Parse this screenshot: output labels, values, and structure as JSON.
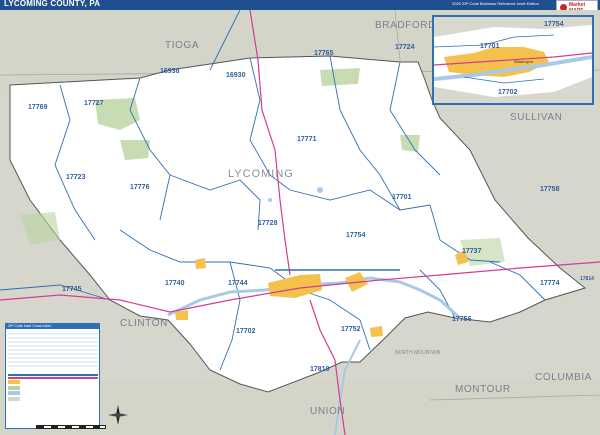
{
  "map": {
    "title": "LYCOMING COUNTY, PA",
    "subtitle": "2020 ZIP Code Business Reference Inset Edition",
    "brand": "Market MAPS",
    "colors": {
      "county_fill": "#ffffff",
      "surrounding": "#d6d6cc",
      "zip_boundary": "#2f6fb3",
      "water": "#a9c9e6",
      "urban": "#f5c14d",
      "park": "#b9d3a0",
      "highway": "#d63b8f",
      "title_bar": "#1f4f8f"
    }
  },
  "counties": {
    "tioga": "TIOGA",
    "bradford": "BRADFORD",
    "sullivan": "SULLIVAN",
    "lycoming": "LYCOMING",
    "clinton": "CLINTON",
    "montour": "MONTOUR",
    "columbia": "COLUMBIA",
    "union": "UNION"
  },
  "zip_codes": {
    "z16938": "16938",
    "z16930": "16930",
    "z17765": "17765",
    "z17724": "17724",
    "z17769": "17769",
    "z17727": "17727",
    "z17771": "17771",
    "z17723": "17723",
    "z17776": "17776",
    "z17758": "17758",
    "z17701": "17701",
    "z17728": "17728",
    "z17754": "17754",
    "z17737": "17737",
    "z17740": "17740",
    "z17744": "17744",
    "z17774": "17774",
    "z17745": "17745",
    "z17814": "17814",
    "z17756": "17756",
    "z17702": "17702",
    "z17752": "17752",
    "z17810": "17810",
    "inset_17701": "17701",
    "inset_17702": "17702",
    "inset_17754": "17754"
  },
  "inset": {
    "city": "Williamsport"
  },
  "legend": {
    "header": "ZIP Code Inset Cross Index"
  },
  "places": {
    "north_mountain": "NORTH MOUNTAIN"
  }
}
